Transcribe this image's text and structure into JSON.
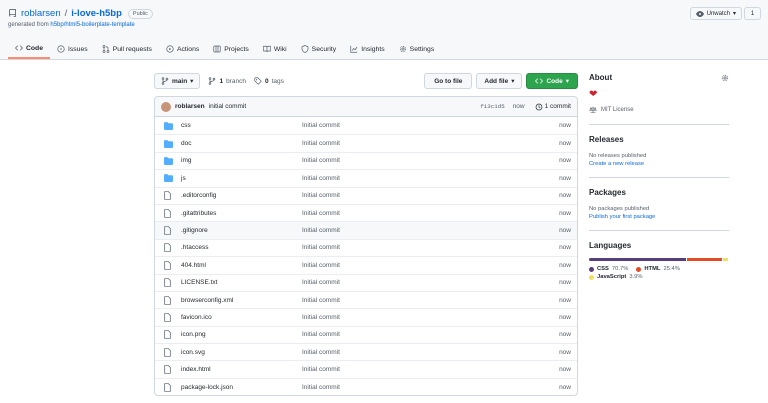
{
  "repo": {
    "owner": "roblarsen",
    "sep": "/",
    "name": "i-love-h5bp",
    "visibility": "Public",
    "generated_prefix": "generated from",
    "generated_from": "h5bp/html5-boilerplate-template",
    "watch_label": "Unwatch",
    "watch_count": "1"
  },
  "tabs": [
    {
      "label": "Code",
      "icon": "code-icon"
    },
    {
      "label": "Issues",
      "icon": "issue-icon"
    },
    {
      "label": "Pull requests",
      "icon": "pull-request-icon"
    },
    {
      "label": "Actions",
      "icon": "play-icon"
    },
    {
      "label": "Projects",
      "icon": "table-icon"
    },
    {
      "label": "Wiki",
      "icon": "book-icon"
    },
    {
      "label": "Security",
      "icon": "shield-icon"
    },
    {
      "label": "Insights",
      "icon": "graph-icon"
    },
    {
      "label": "Settings",
      "icon": "gear-icon"
    }
  ],
  "toolbar": {
    "branch": "main",
    "branch_count": "1",
    "branch_word": "branch",
    "tag_count": "0",
    "tag_word": "tags",
    "goto_label": "Go to file",
    "add_label": "Add file",
    "code_label": "Code"
  },
  "commit": {
    "author": "roblarsen",
    "message": "initial commit",
    "sha": "f13c1d5",
    "time": "now",
    "count": "1 commit"
  },
  "files": [
    {
      "name": "css",
      "type": "dir",
      "message": "Initial commit",
      "time": "now"
    },
    {
      "name": "doc",
      "type": "dir",
      "message": "Initial commit",
      "time": "now"
    },
    {
      "name": "img",
      "type": "dir",
      "message": "Initial commit",
      "time": "now"
    },
    {
      "name": "js",
      "type": "dir",
      "message": "Initial commit",
      "time": "now"
    },
    {
      "name": ".editorconfig",
      "type": "file",
      "message": "Initial commit",
      "time": "now"
    },
    {
      "name": ".gitattributes",
      "type": "file",
      "message": "Initial commit",
      "time": "now"
    },
    {
      "name": ".gitignore",
      "type": "file",
      "message": "Initial commit",
      "time": "now"
    },
    {
      "name": ".htaccess",
      "type": "file",
      "message": "Initial commit",
      "time": "now"
    },
    {
      "name": "404.html",
      "type": "file",
      "message": "Initial commit",
      "time": "now"
    },
    {
      "name": "LICENSE.txt",
      "type": "file",
      "message": "Initial commit",
      "time": "now"
    },
    {
      "name": "browserconfig.xml",
      "type": "file",
      "message": "Initial commit",
      "time": "now"
    },
    {
      "name": "favicon.ico",
      "type": "file",
      "message": "Initial commit",
      "time": "now"
    },
    {
      "name": "icon.png",
      "type": "file",
      "message": "Initial commit",
      "time": "now"
    },
    {
      "name": "icon.svg",
      "type": "file",
      "message": "Initial commit",
      "time": "now"
    },
    {
      "name": "index.html",
      "type": "file",
      "message": "Initial commit",
      "time": "now"
    },
    {
      "name": "package-lock.json",
      "type": "file",
      "message": "Initial commit",
      "time": "now"
    }
  ],
  "sidebar": {
    "about_title": "About",
    "license": "MIT License",
    "releases_title": "Releases",
    "releases_text": "No releases published",
    "releases_link": "Create a new release",
    "packages_title": "Packages",
    "packages_text": "No packages published",
    "packages_link": "Publish your first package",
    "languages_title": "Languages",
    "languages": [
      {
        "name": "CSS",
        "percent": "70.7%",
        "value": 70.7,
        "color": "#563d7c"
      },
      {
        "name": "HTML",
        "percent": "25.4%",
        "value": 25.4,
        "color": "#e34c26"
      },
      {
        "name": "JavaScript",
        "percent": "3.9%",
        "value": 3.9,
        "color": "#f1e05a"
      }
    ]
  }
}
